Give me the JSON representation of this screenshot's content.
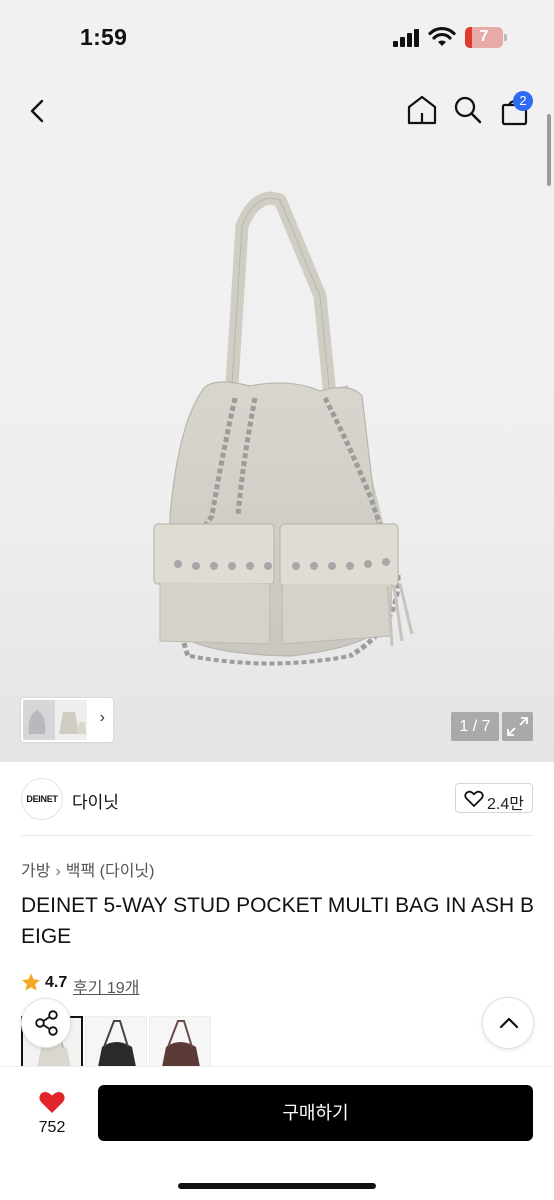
{
  "status_bar": {
    "time": "1:59",
    "battery": "7"
  },
  "nav": {
    "cart_count": "2"
  },
  "gallery": {
    "counter": "1 / 7"
  },
  "brand": {
    "logo_text": "DEINET",
    "name": "다이닛",
    "likes": "2.4만"
  },
  "breadcrumb": {
    "category": "가방",
    "subcategory": "백팩 (다이닛)"
  },
  "product": {
    "title": "DEINET 5-WAY STUD POCKET MULTI BAG IN ASH BEIGE",
    "rating": "4.7",
    "reviews": "후기 19개"
  },
  "variants": [
    {
      "name": "ash beige",
      "color": "#d9d7cf"
    },
    {
      "name": "black",
      "color": "#2a2a2a"
    },
    {
      "name": "brown",
      "color": "#5a3a34"
    }
  ],
  "bottom": {
    "wish_count": "752",
    "buy_label": "구매하기"
  },
  "colors": {
    "accent_badge": "#2f6bf2",
    "heart": "#e0262b",
    "star": "#f5a623",
    "buy_button": "#000000"
  }
}
